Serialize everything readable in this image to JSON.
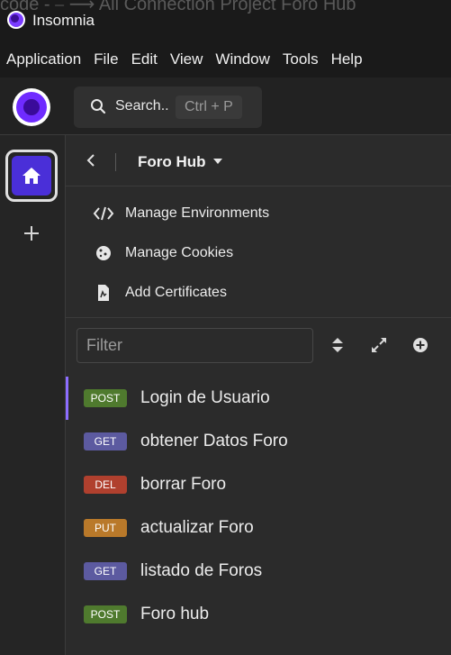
{
  "window": {
    "title": "Insomnia",
    "ghost_title": "code - ⎯ ⟶ All Connection Project Foro Hub"
  },
  "menu": [
    "Application",
    "File",
    "Edit",
    "View",
    "Window",
    "Tools",
    "Help"
  ],
  "search": {
    "label": "Search..",
    "shortcut": "Ctrl + P"
  },
  "project": {
    "name": "Foro Hub"
  },
  "manage": {
    "environments": "Manage Environments",
    "cookies": "Manage Cookies",
    "certificates": "Add Certificates"
  },
  "filter": {
    "placeholder": "Filter",
    "value": ""
  },
  "colors": {
    "POST": "#4f7a2e",
    "GET": "#5c5aa0",
    "DEL": "#b0402e",
    "PUT": "#b9792a",
    "accent": "#8c6dff",
    "brand": "#6f2bff"
  },
  "requests": [
    {
      "method": "POST",
      "name": "Login de Usuario",
      "active": true
    },
    {
      "method": "GET",
      "name": "obtener Datos Foro",
      "active": false
    },
    {
      "method": "DEL",
      "name": "borrar Foro",
      "active": false
    },
    {
      "method": "PUT",
      "name": "actualizar Foro",
      "active": false
    },
    {
      "method": "GET",
      "name": "listado de Foros",
      "active": false
    },
    {
      "method": "POST",
      "name": "Foro hub",
      "active": false
    }
  ]
}
